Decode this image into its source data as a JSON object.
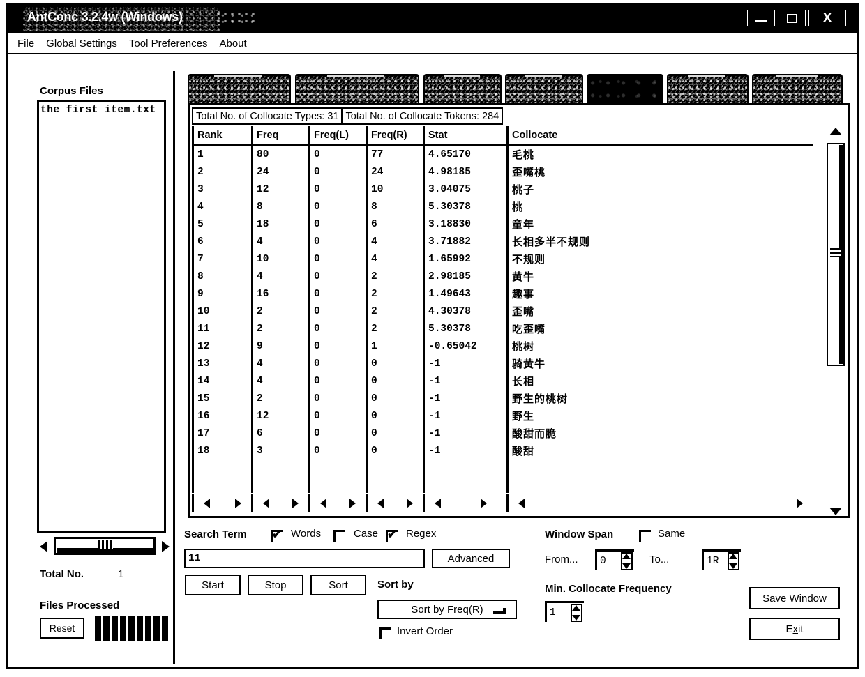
{
  "window": {
    "title": "AntConc 3.2.4w (Windows)",
    "controls": {
      "minimize": "minimize-icon",
      "maximize": "maximize-icon",
      "close": "X"
    }
  },
  "menu": {
    "items": [
      "File",
      "Global Settings",
      "Tool Preferences",
      "About"
    ]
  },
  "sidebar": {
    "title": "Corpus Files",
    "files": [
      "the first item.txt"
    ],
    "total_label": "Total No.",
    "total_value": "1",
    "files_processed_label": "Files Processed",
    "reset_label": "Reset"
  },
  "tabs": [
    {
      "label": "",
      "selected": false
    },
    {
      "label": "",
      "selected": false
    },
    {
      "label": "",
      "selected": false
    },
    {
      "label": "",
      "selected": false
    },
    {
      "label": "",
      "selected": true
    },
    {
      "label": "",
      "selected": false
    },
    {
      "label": "",
      "selected": false
    }
  ],
  "results": {
    "types_total": "Total No. of Collocate Types: 31",
    "tokens_total": "Total No. of Collocate Tokens: 284",
    "columns": [
      "Rank",
      "Freq",
      "Freq(L)",
      "Freq(R)",
      "Stat",
      "Collocate"
    ],
    "rows": [
      {
        "rank": "1",
        "freq": "80",
        "freq_l": "0",
        "freq_r": "77",
        "stat": "4.65170",
        "collocate": "毛桃"
      },
      {
        "rank": "2",
        "freq": "24",
        "freq_l": "0",
        "freq_r": "24",
        "stat": "4.98185",
        "collocate": "歪嘴桃"
      },
      {
        "rank": "3",
        "freq": "12",
        "freq_l": "0",
        "freq_r": "10",
        "stat": "3.04075",
        "collocate": "桃子"
      },
      {
        "rank": "4",
        "freq": "8",
        "freq_l": "0",
        "freq_r": "8",
        "stat": "5.30378",
        "collocate": "桃"
      },
      {
        "rank": "5",
        "freq": "18",
        "freq_l": "0",
        "freq_r": "6",
        "stat": "3.18830",
        "collocate": "童年"
      },
      {
        "rank": "6",
        "freq": "4",
        "freq_l": "0",
        "freq_r": "4",
        "stat": "3.71882",
        "collocate": "长相多半不规则"
      },
      {
        "rank": "7",
        "freq": "10",
        "freq_l": "0",
        "freq_r": "4",
        "stat": "1.65992",
        "collocate": "不规则"
      },
      {
        "rank": "8",
        "freq": "4",
        "freq_l": "0",
        "freq_r": "2",
        "stat": "2.98185",
        "collocate": "黄牛"
      },
      {
        "rank": "9",
        "freq": "16",
        "freq_l": "0",
        "freq_r": "2",
        "stat": "1.49643",
        "collocate": "趣事"
      },
      {
        "rank": "10",
        "freq": "2",
        "freq_l": "0",
        "freq_r": "2",
        "stat": "4.30378",
        "collocate": "歪嘴"
      },
      {
        "rank": "11",
        "freq": "2",
        "freq_l": "0",
        "freq_r": "2",
        "stat": "5.30378",
        "collocate": "吃歪嘴"
      },
      {
        "rank": "12",
        "freq": "9",
        "freq_l": "0",
        "freq_r": "1",
        "stat": "-0.65042",
        "collocate": "桃树"
      },
      {
        "rank": "13",
        "freq": "4",
        "freq_l": "0",
        "freq_r": "0",
        "stat": "-1",
        "collocate": "骑黄牛"
      },
      {
        "rank": "14",
        "freq": "4",
        "freq_l": "0",
        "freq_r": "0",
        "stat": "-1",
        "collocate": "长相"
      },
      {
        "rank": "15",
        "freq": "2",
        "freq_l": "0",
        "freq_r": "0",
        "stat": "-1",
        "collocate": "野生的桃树"
      },
      {
        "rank": "16",
        "freq": "12",
        "freq_l": "0",
        "freq_r": "0",
        "stat": "-1",
        "collocate": "野生"
      },
      {
        "rank": "17",
        "freq": "6",
        "freq_l": "0",
        "freq_r": "0",
        "stat": "-1",
        "collocate": "酸甜而脆"
      },
      {
        "rank": "18",
        "freq": "3",
        "freq_l": "0",
        "freq_r": "0",
        "stat": "-1",
        "collocate": "酸甜"
      }
    ]
  },
  "search": {
    "label": "Search Term",
    "value": "11",
    "placeholder": "",
    "words_label": "Words",
    "words_checked": true,
    "case_label": "Case",
    "case_checked": false,
    "regex_label": "Regex",
    "regex_checked": true,
    "advanced_label": "Advanced",
    "start_label": "Start",
    "stop_label": "Stop",
    "sort_label": "Sort"
  },
  "sort": {
    "label": "Sort by",
    "selected": "Sort by Freq(R)",
    "invert_label": "Invert Order",
    "invert_checked": false
  },
  "window_span": {
    "label": "Window Span",
    "same_label": "Same",
    "same_checked": false,
    "from_label": "From...",
    "from_value": "0",
    "to_label": "To...",
    "to_value": "1R"
  },
  "min_collocate": {
    "label": "Min. Collocate Frequency",
    "value": "1"
  },
  "actions": {
    "save_window_label": "Save Window",
    "exit_label_pre": "E",
    "exit_label_key": "x",
    "exit_label_post": "it"
  }
}
